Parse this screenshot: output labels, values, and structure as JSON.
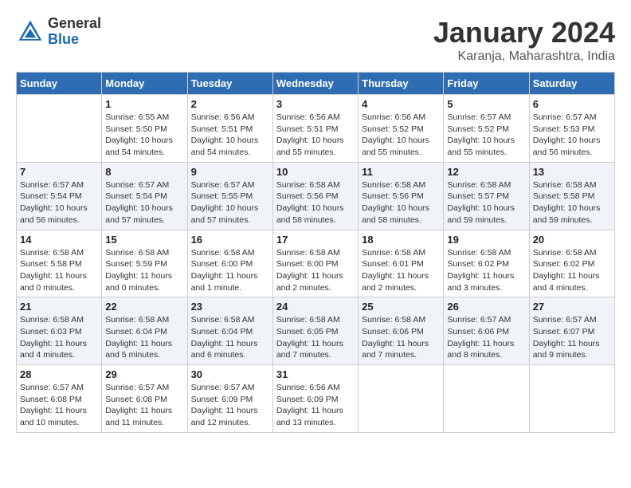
{
  "header": {
    "logo_line1": "General",
    "logo_line2": "Blue",
    "month": "January 2024",
    "location": "Karanja, Maharashtra, India"
  },
  "weekdays": [
    "Sunday",
    "Monday",
    "Tuesday",
    "Wednesday",
    "Thursday",
    "Friday",
    "Saturday"
  ],
  "weeks": [
    [
      {
        "day": "",
        "info": ""
      },
      {
        "day": "1",
        "info": "Sunrise: 6:55 AM\nSunset: 5:50 PM\nDaylight: 10 hours\nand 54 minutes."
      },
      {
        "day": "2",
        "info": "Sunrise: 6:56 AM\nSunset: 5:51 PM\nDaylight: 10 hours\nand 54 minutes."
      },
      {
        "day": "3",
        "info": "Sunrise: 6:56 AM\nSunset: 5:51 PM\nDaylight: 10 hours\nand 55 minutes."
      },
      {
        "day": "4",
        "info": "Sunrise: 6:56 AM\nSunset: 5:52 PM\nDaylight: 10 hours\nand 55 minutes."
      },
      {
        "day": "5",
        "info": "Sunrise: 6:57 AM\nSunset: 5:52 PM\nDaylight: 10 hours\nand 55 minutes."
      },
      {
        "day": "6",
        "info": "Sunrise: 6:57 AM\nSunset: 5:53 PM\nDaylight: 10 hours\nand 56 minutes."
      }
    ],
    [
      {
        "day": "7",
        "info": "Sunrise: 6:57 AM\nSunset: 5:54 PM\nDaylight: 10 hours\nand 56 minutes."
      },
      {
        "day": "8",
        "info": "Sunrise: 6:57 AM\nSunset: 5:54 PM\nDaylight: 10 hours\nand 57 minutes."
      },
      {
        "day": "9",
        "info": "Sunrise: 6:57 AM\nSunset: 5:55 PM\nDaylight: 10 hours\nand 57 minutes."
      },
      {
        "day": "10",
        "info": "Sunrise: 6:58 AM\nSunset: 5:56 PM\nDaylight: 10 hours\nand 58 minutes."
      },
      {
        "day": "11",
        "info": "Sunrise: 6:58 AM\nSunset: 5:56 PM\nDaylight: 10 hours\nand 58 minutes."
      },
      {
        "day": "12",
        "info": "Sunrise: 6:58 AM\nSunset: 5:57 PM\nDaylight: 10 hours\nand 59 minutes."
      },
      {
        "day": "13",
        "info": "Sunrise: 6:58 AM\nSunset: 5:58 PM\nDaylight: 10 hours\nand 59 minutes."
      }
    ],
    [
      {
        "day": "14",
        "info": "Sunrise: 6:58 AM\nSunset: 5:58 PM\nDaylight: 11 hours\nand 0 minutes."
      },
      {
        "day": "15",
        "info": "Sunrise: 6:58 AM\nSunset: 5:59 PM\nDaylight: 11 hours\nand 0 minutes."
      },
      {
        "day": "16",
        "info": "Sunrise: 6:58 AM\nSunset: 6:00 PM\nDaylight: 11 hours\nand 1 minute."
      },
      {
        "day": "17",
        "info": "Sunrise: 6:58 AM\nSunset: 6:00 PM\nDaylight: 11 hours\nand 2 minutes."
      },
      {
        "day": "18",
        "info": "Sunrise: 6:58 AM\nSunset: 6:01 PM\nDaylight: 11 hours\nand 2 minutes."
      },
      {
        "day": "19",
        "info": "Sunrise: 6:58 AM\nSunset: 6:02 PM\nDaylight: 11 hours\nand 3 minutes."
      },
      {
        "day": "20",
        "info": "Sunrise: 6:58 AM\nSunset: 6:02 PM\nDaylight: 11 hours\nand 4 minutes."
      }
    ],
    [
      {
        "day": "21",
        "info": "Sunrise: 6:58 AM\nSunset: 6:03 PM\nDaylight: 11 hours\nand 4 minutes."
      },
      {
        "day": "22",
        "info": "Sunrise: 6:58 AM\nSunset: 6:04 PM\nDaylight: 11 hours\nand 5 minutes."
      },
      {
        "day": "23",
        "info": "Sunrise: 6:58 AM\nSunset: 6:04 PM\nDaylight: 11 hours\nand 6 minutes."
      },
      {
        "day": "24",
        "info": "Sunrise: 6:58 AM\nSunset: 6:05 PM\nDaylight: 11 hours\nand 7 minutes."
      },
      {
        "day": "25",
        "info": "Sunrise: 6:58 AM\nSunset: 6:06 PM\nDaylight: 11 hours\nand 7 minutes."
      },
      {
        "day": "26",
        "info": "Sunrise: 6:57 AM\nSunset: 6:06 PM\nDaylight: 11 hours\nand 8 minutes."
      },
      {
        "day": "27",
        "info": "Sunrise: 6:57 AM\nSunset: 6:07 PM\nDaylight: 11 hours\nand 9 minutes."
      }
    ],
    [
      {
        "day": "28",
        "info": "Sunrise: 6:57 AM\nSunset: 6:08 PM\nDaylight: 11 hours\nand 10 minutes."
      },
      {
        "day": "29",
        "info": "Sunrise: 6:57 AM\nSunset: 6:08 PM\nDaylight: 11 hours\nand 11 minutes."
      },
      {
        "day": "30",
        "info": "Sunrise: 6:57 AM\nSunset: 6:09 PM\nDaylight: 11 hours\nand 12 minutes."
      },
      {
        "day": "31",
        "info": "Sunrise: 6:56 AM\nSunset: 6:09 PM\nDaylight: 11 hours\nand 13 minutes."
      },
      {
        "day": "",
        "info": ""
      },
      {
        "day": "",
        "info": ""
      },
      {
        "day": "",
        "info": ""
      }
    ]
  ]
}
